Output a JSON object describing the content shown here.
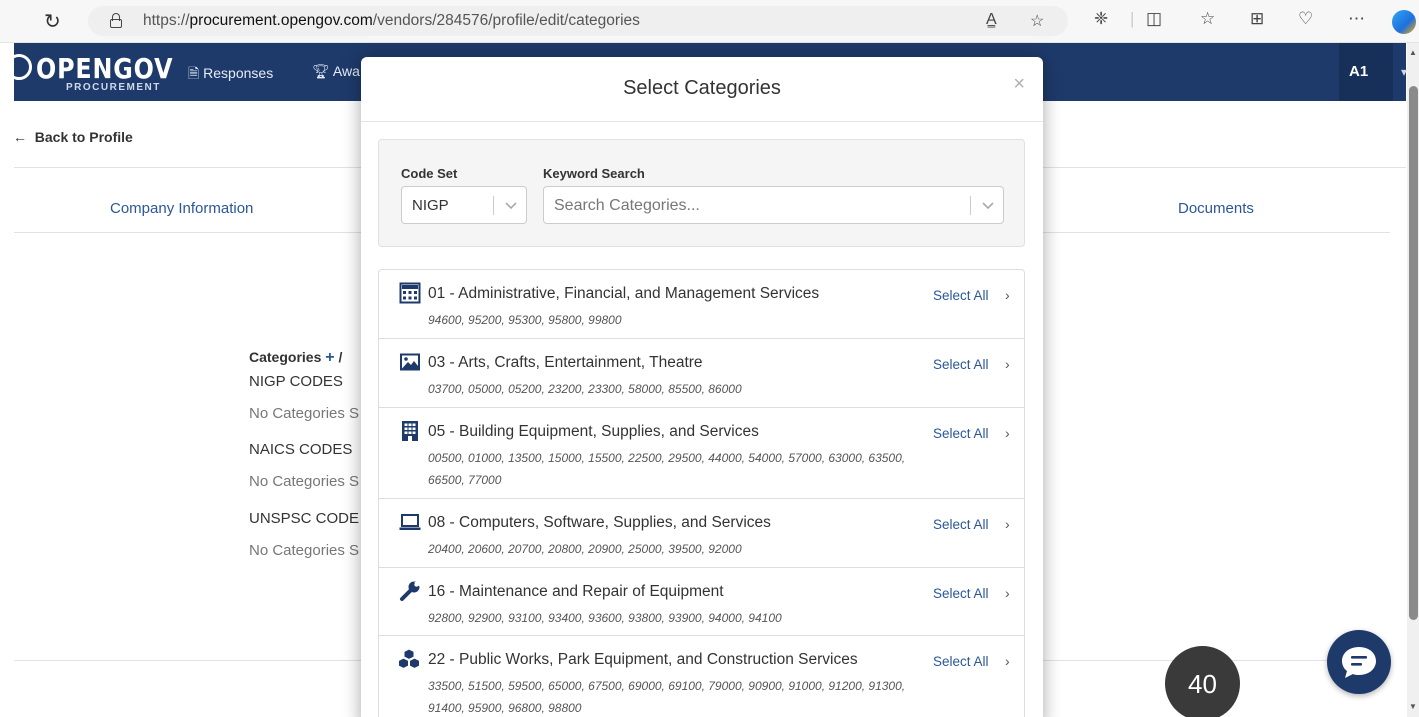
{
  "browser": {
    "url_prefix": "https://",
    "url_domain": "procurement.opengov.com",
    "url_path": "/vendors/284576/profile/edit/categories",
    "read_aloud_label": "A͇",
    "toolbar_icons": [
      "favorite-icon",
      "extensions-icon",
      "split-screen-icon",
      "favorites-list-icon",
      "collections-icon",
      "performance-icon",
      "more-icon",
      "copilot-icon"
    ]
  },
  "header": {
    "logo_main": "OPENGOV",
    "logo_sub": "PROCUREMENT",
    "nav": [
      {
        "label": "Responses",
        "icon": "document-icon"
      },
      {
        "label": "Awa",
        "icon": "trophy-icon"
      }
    ],
    "avatar": "A1"
  },
  "page": {
    "back_link": "Back to Profile",
    "tabs": [
      "Company Information",
      "Documents"
    ],
    "categories_heading": "Categories",
    "categories_suffix": "/",
    "code_sections": [
      {
        "name": "NIGP CODES",
        "status": "No Categories S"
      },
      {
        "name": "NAICS CODES",
        "status": "No Categories S"
      },
      {
        "name": "UNSPSC CODE",
        "status": "No Categories S"
      }
    ]
  },
  "modal": {
    "title": "Select Categories",
    "close": "×",
    "code_set_label": "Code Set",
    "code_set_value": "NIGP",
    "keyword_label": "Keyword Search",
    "keyword_placeholder": "Search Categories...",
    "select_all_label": "Select All",
    "categories": [
      {
        "title": "01 - Administrative, Financial, and Management Services",
        "codes": "94600, 95200, 95300, 95800, 99800",
        "icon": "calculator-icon"
      },
      {
        "title": "03 - Arts, Crafts, Entertainment, Theatre",
        "codes": "03700, 05000, 05200, 23200, 23300, 58000, 85500, 86000",
        "icon": "image-icon"
      },
      {
        "title": "05 - Building Equipment, Supplies, and Services",
        "codes": "00500, 01000, 13500, 15000, 15500, 22500, 29500, 44000, 54000, 57000, 63000, 63500, 66500, 77000",
        "icon": "building-icon"
      },
      {
        "title": "08 - Computers, Software, Supplies, and Services",
        "codes": "20400, 20600, 20700, 20800, 20900, 25000, 39500, 92000",
        "icon": "laptop-icon"
      },
      {
        "title": "16 - Maintenance and Repair of Equipment",
        "codes": "92800, 92900, 93100, 93400, 93600, 93800, 93900, 94000, 94100",
        "icon": "wrench-icon"
      },
      {
        "title": "22 - Public Works, Park Equipment, and Construction Services",
        "codes": "33500, 51500, 59500, 65000, 67500, 69000, 69100, 79000, 90900, 91000, 91200, 91300, 91400, 95900, 96800, 98800",
        "icon": "cubes-icon"
      }
    ]
  },
  "floating": {
    "badge": "40",
    "chat_icon": "chat-icon"
  },
  "colors": {
    "header": "#1e3a6b",
    "link": "#2b5797"
  }
}
